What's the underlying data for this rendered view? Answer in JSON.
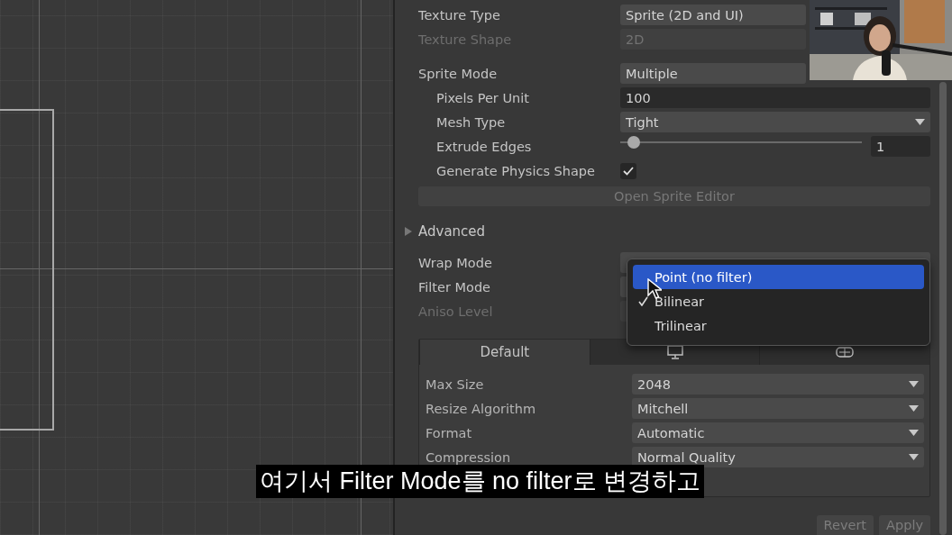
{
  "inspector": {
    "groups": [
      [
        {
          "kind": "dropdown",
          "label": "Texture Type",
          "value": "Sprite (2D and UI)",
          "disabled": false
        },
        {
          "kind": "dropdown",
          "label": "Texture Shape",
          "value": "2D",
          "disabled": true
        }
      ],
      [
        {
          "kind": "dropdown",
          "label": "Sprite Mode",
          "value": "Multiple",
          "disabled": false,
          "children": [
            {
              "kind": "text",
              "label": "Pixels Per Unit",
              "value": "100",
              "disabled": false
            },
            {
              "kind": "dropdown",
              "label": "Mesh Type",
              "value": "Tight",
              "disabled": false
            },
            {
              "kind": "slider",
              "label": "Extrude Edges",
              "value": "1",
              "level": 0.03,
              "disabled": false
            },
            {
              "kind": "checkbox",
              "label": "Generate Physics Shape",
              "checked": true,
              "disabled": false
            }
          ]
        }
      ]
    ],
    "sprite_editor_button": {
      "label": "Open Sprite Editor",
      "disabled": true
    },
    "advanced": {
      "label": "Advanced",
      "expanded": false
    },
    "sampling": [
      {
        "kind": "dropdown",
        "label": "Wrap Mode",
        "disabled": false
      },
      {
        "kind": "dropdown",
        "label": "Filter Mode",
        "disabled": false
      },
      {
        "kind": "dropdown",
        "label": "Aniso Level",
        "disabled": true
      }
    ],
    "filter_menu": {
      "options": [
        {
          "label": "Point (no filter)",
          "selected": true,
          "checked": false
        },
        {
          "label": "Bilinear",
          "selected": false,
          "checked": true
        },
        {
          "label": "Trilinear",
          "selected": false,
          "checked": false
        }
      ]
    },
    "platform_tabs": [
      {
        "kind": "label",
        "label": "Default",
        "selected": true
      },
      {
        "kind": "monitor",
        "selected": false
      },
      {
        "kind": "web",
        "selected": false
      }
    ],
    "platform_rows": [
      {
        "label": "Max Size",
        "value": "2048"
      },
      {
        "label": "Resize Algorithm",
        "value": "Mitchell"
      },
      {
        "label": "Format",
        "value": "Automatic"
      },
      {
        "label": "Compression",
        "value": "Normal Quality"
      }
    ],
    "buttons": [
      {
        "label": "Revert",
        "disabled": true
      },
      {
        "label": "Apply",
        "disabled": true
      }
    ]
  },
  "subtitle": "여기서 Filter Mode를 no filter로 변경하고"
}
